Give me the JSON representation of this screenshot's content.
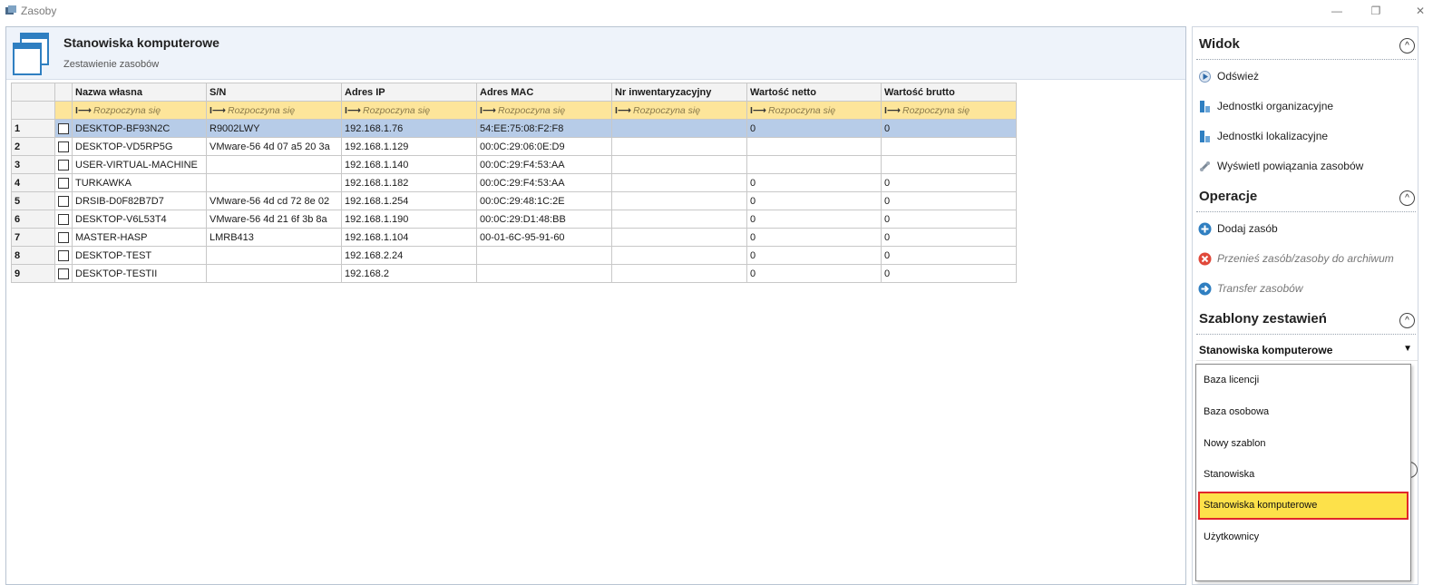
{
  "window": {
    "title": "Zasoby",
    "minimize_glyph": "—",
    "restore_glyph": "❐",
    "close_glyph": "✕"
  },
  "header": {
    "title": "Stanowiska komputerowe",
    "subtitle": "Zestawienie zasobów"
  },
  "table": {
    "columns": [
      "Nazwa własna",
      "S/N",
      "Adres IP",
      "Adres MAC",
      "Nr inwentaryzacyjny",
      "Wartość netto",
      "Wartość brutto"
    ],
    "filter_text": "Rozpoczyna się",
    "rows": [
      {
        "num": "1",
        "name": "DESKTOP-BF93N2C",
        "sn": "R9002LWY",
        "ip": "192.168.1.76",
        "mac": "54:EE:75:08:F2:F8",
        "inv": "",
        "net": "0",
        "gross": "0",
        "selected": true
      },
      {
        "num": "2",
        "name": "DESKTOP-VD5RP5G",
        "sn": "VMware-56 4d 07 a5 20 3a",
        "ip": "192.168.1.129",
        "mac": "00:0C:29:06:0E:D9",
        "inv": "",
        "net": "",
        "gross": ""
      },
      {
        "num": "3",
        "name": "USER-VIRTUAL-MACHINE",
        "sn": "",
        "ip": "192.168.1.140",
        "mac": "00:0C:29:F4:53:AA",
        "inv": "",
        "net": "",
        "gross": ""
      },
      {
        "num": "4",
        "name": "TURKAWKA",
        "sn": "",
        "ip": "192.168.1.182",
        "mac": "00:0C:29:F4:53:AA",
        "inv": "",
        "net": "0",
        "gross": "0"
      },
      {
        "num": "5",
        "name": "DRSIB-D0F82B7D7",
        "sn": "VMware-56 4d cd 72 8e 02",
        "ip": "192.168.1.254",
        "mac": "00:0C:29:48:1C:2E",
        "inv": "",
        "net": "0",
        "gross": "0"
      },
      {
        "num": "6",
        "name": "DESKTOP-V6L53T4",
        "sn": "VMware-56 4d 21 6f 3b 8a",
        "ip": "192.168.1.190",
        "mac": "00:0C:29:D1:48:BB",
        "inv": "",
        "net": "0",
        "gross": "0"
      },
      {
        "num": "7",
        "name": "MASTER-HASP",
        "sn": "LMRB413",
        "ip": "192.168.1.104",
        "mac": "00-01-6C-95-91-60",
        "inv": "",
        "net": "0",
        "gross": "0"
      },
      {
        "num": "8",
        "name": "DESKTOP-TEST",
        "sn": "",
        "ip": "192.168.2.24",
        "mac": "",
        "inv": "",
        "net": "0",
        "gross": "0"
      },
      {
        "num": "9",
        "name": "DESKTOP-TESTII",
        "sn": "",
        "ip": "192.168.2",
        "mac": "",
        "inv": "",
        "net": "0",
        "gross": "0"
      }
    ]
  },
  "sidebar": {
    "widok": {
      "title": "Widok",
      "items": [
        "Odśwież",
        "Jednostki organizacyjne",
        "Jednostki lokalizacyjne",
        "Wyświetl powiązania zasobów"
      ]
    },
    "operacje": {
      "title": "Operacje",
      "items": [
        "Dodaj zasób",
        "Przenieś zasób/zasoby do archiwum",
        "Transfer zasobów"
      ]
    },
    "szablony": {
      "title": "Szablony zestawień",
      "selected": "Stanowiska komputerowe",
      "options": [
        "Baza licencji",
        "Baza osobowa",
        "Nowy szablon",
        "Stanowiska",
        "Stanowiska komputerowe",
        "Użytkownicy"
      ]
    },
    "collapse_glyph": "^"
  },
  "colors": {
    "accent": "#2f7fc1",
    "selected_row": "#b7cce8",
    "filter_row": "#fde59a",
    "highlight": "#fde14a",
    "highlight_border": "#e0262b"
  }
}
